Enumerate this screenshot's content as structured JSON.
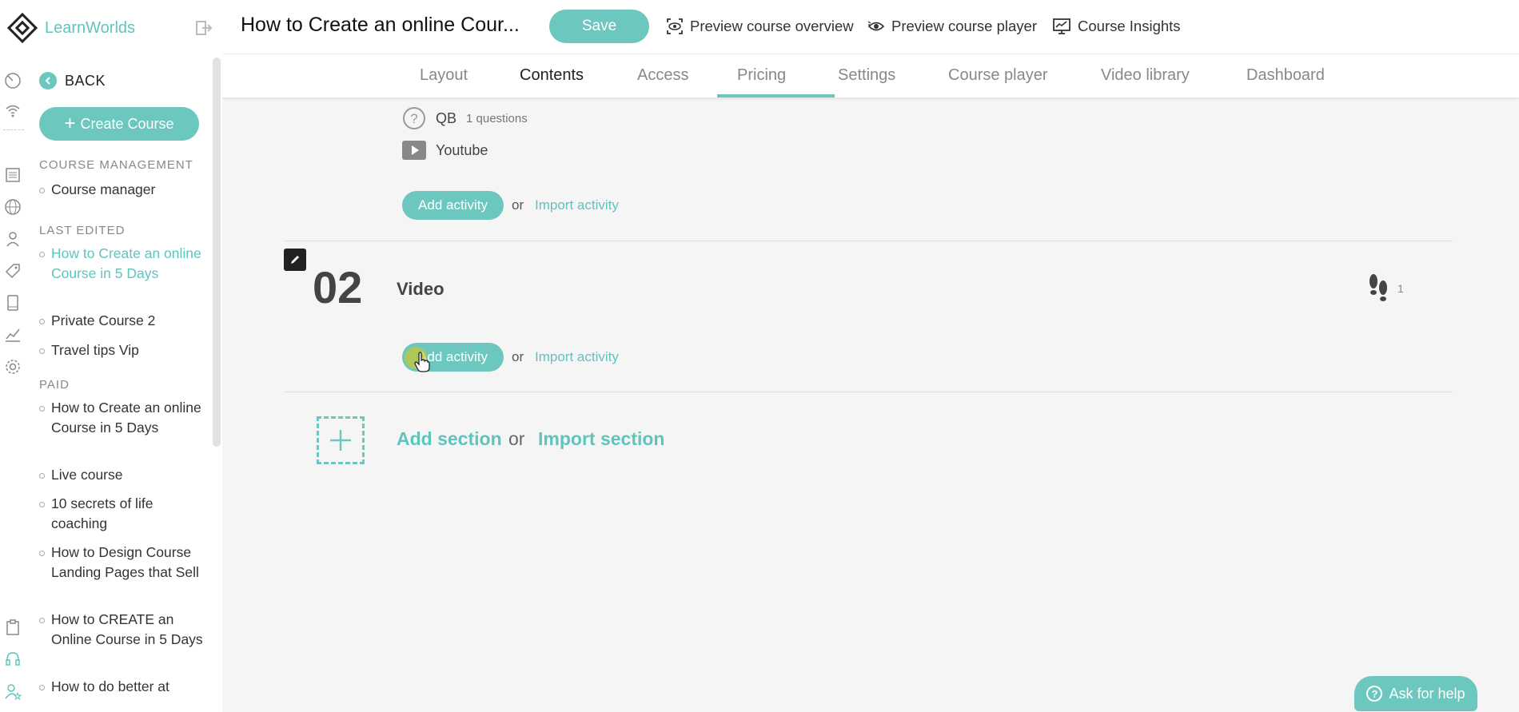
{
  "brand": {
    "name": "LearnWorlds"
  },
  "header": {
    "course_title": "How to Create an online Cour...",
    "save_label": "Save",
    "links": [
      "Preview course overview",
      "Preview course player",
      "Course Insights"
    ]
  },
  "tabs": [
    "Layout",
    "Contents",
    "Access",
    "Pricing",
    "Settings",
    "Course player",
    "Video library",
    "Dashboard"
  ],
  "active_tab": "Contents",
  "sidebar": {
    "back_label": "BACK",
    "create_label": "Create Course",
    "sections": {
      "management": "COURSE MANAGEMENT",
      "last_edited": "LAST EDITED",
      "paid": "PAID"
    },
    "management_items": [
      "Course manager"
    ],
    "last_edited_items": [
      "How to Create an online Course in 5 Days",
      "Private Course 2",
      "Travel tips Vip"
    ],
    "paid_items": [
      "How to Create an online Course in 5 Days",
      "Live course",
      "10 secrets of life coaching",
      "How to Design Course Landing Pages that Sell",
      "How to CREATE an Online Course in 5 Days",
      "How to do better at"
    ]
  },
  "content": {
    "activities": [
      {
        "icon": "question-icon",
        "label": "QB",
        "meta": "1 questions"
      },
      {
        "icon": "youtube-icon",
        "label": "Youtube",
        "meta": ""
      }
    ],
    "add_activity": "Add activity",
    "or": "or",
    "import_activity": "Import activity",
    "section": {
      "number": "02",
      "title": "Video",
      "footprints_count": "1"
    },
    "add_section": "Add section",
    "import_section": "Import section"
  },
  "help": {
    "label": "Ask for help"
  },
  "colors": {
    "accent": "#6cc7bf",
    "text": "#333333",
    "background": "#f5f5f5"
  }
}
